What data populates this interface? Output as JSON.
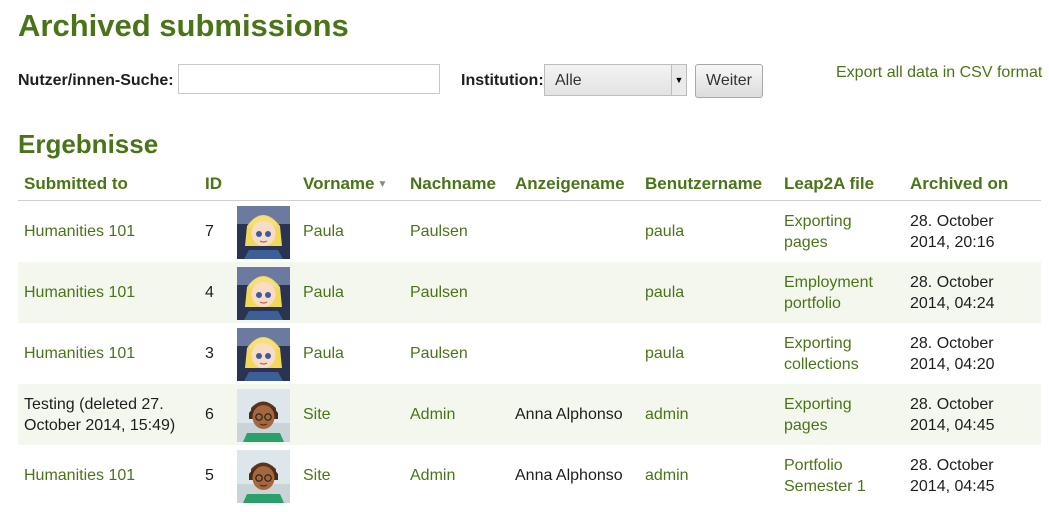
{
  "page": {
    "title": "Archived submissions"
  },
  "search": {
    "label": "Nutzer/innen-Suche:",
    "value": "",
    "placeholder": "",
    "institution_label": "Institution:",
    "institution_value": "Alle",
    "go_label": "Weiter"
  },
  "export": {
    "label": "Export all data in CSV format"
  },
  "results": {
    "heading": "Ergebnisse",
    "columns": {
      "submitted_to": "Submitted to",
      "id": "ID",
      "firstname": "Vorname",
      "lastname": "Nachname",
      "displayname": "Anzeigename",
      "username": "Benutzername",
      "leap2a": "Leap2A file",
      "archived": "Archived on"
    },
    "rows": [
      {
        "submitted_to": "Humanities 101",
        "submitted_link": true,
        "id": "7",
        "avatar": "paula-avatar",
        "firstname": "Paula",
        "lastname": "Paulsen",
        "displayname": "",
        "username": "paula",
        "leap2a": "Exporting pages",
        "archived": "28. October 2014, 20:16"
      },
      {
        "submitted_to": "Humanities 101",
        "submitted_link": true,
        "id": "4",
        "avatar": "paula-avatar",
        "firstname": "Paula",
        "lastname": "Paulsen",
        "displayname": "",
        "username": "paula",
        "leap2a": "Employment portfolio",
        "archived": "28. October 2014, 04:24"
      },
      {
        "submitted_to": "Humanities 101",
        "submitted_link": true,
        "id": "3",
        "avatar": "paula-avatar",
        "firstname": "Paula",
        "lastname": "Paulsen",
        "displayname": "",
        "username": "paula",
        "leap2a": "Exporting collections",
        "archived": "28. October 2014, 04:20"
      },
      {
        "submitted_to": "Testing (deleted 27. October 2014, 15:49)",
        "submitted_link": false,
        "id": "6",
        "avatar": "admin-avatar",
        "firstname": "Site",
        "lastname": "Admin",
        "displayname": "Anna Alphonso",
        "username": "admin",
        "leap2a": "Exporting pages",
        "archived": "28. October 2014, 04:45"
      },
      {
        "submitted_to": "Humanities 101",
        "submitted_link": true,
        "id": "5",
        "avatar": "admin-avatar",
        "firstname": "Site",
        "lastname": "Admin",
        "displayname": "Anna Alphonso",
        "username": "admin",
        "leap2a": "Portfolio Semester 1",
        "archived": "28. October 2014, 04:45"
      }
    ]
  },
  "colors": {
    "accent": "#4a7418",
    "row_alt": "#f4f7ee"
  }
}
